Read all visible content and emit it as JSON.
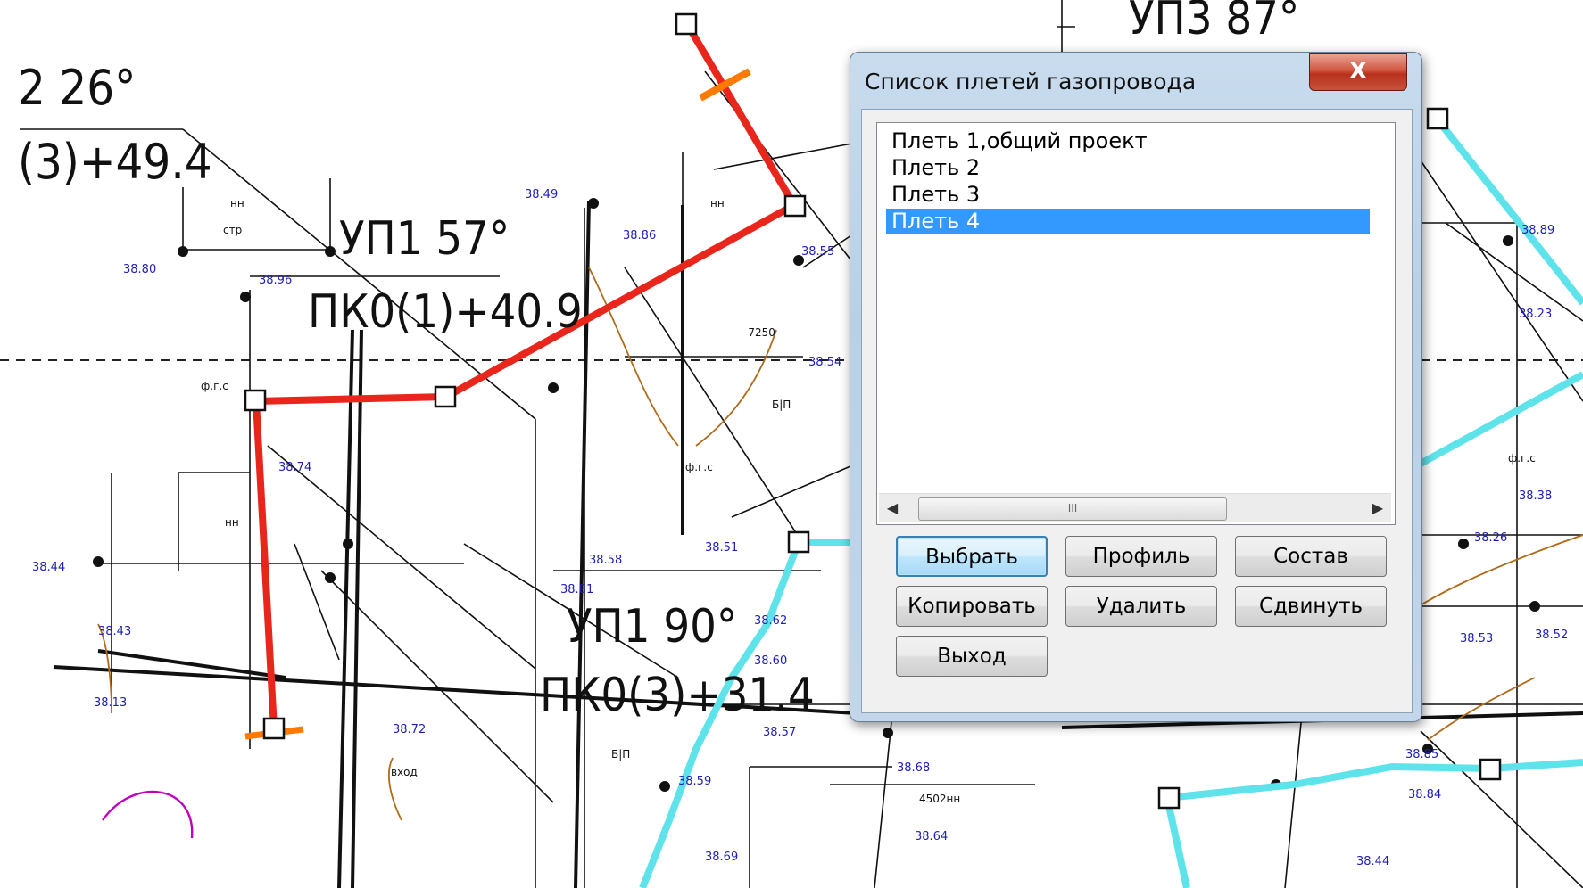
{
  "drawing": {
    "labels": {
      "up2": "2 26°",
      "pk3_49": "(3)+49.4",
      "up1_57": "УП1 57°",
      "pk0_1": "ПК0(1)+40.9",
      "up1_90": "УП1 90°",
      "pk0_3": "ПК0(3)+31.4",
      "up3_87": "УП3 87°"
    },
    "elevations": [
      "38.49",
      "38.80",
      "38.96",
      "38.86",
      "38.55",
      "38.54",
      "38.74",
      "38.44",
      "38.43",
      "38.13",
      "38.58",
      "38.51",
      "38.62",
      "38.60",
      "38.81",
      "38.72",
      "38.57",
      "38.59",
      "38.69",
      "38.68",
      "38.64",
      "38.23",
      "38.38",
      "38.26",
      "38.53",
      "38.52",
      "38.85",
      "38.84",
      "38.89",
      "38.44"
    ],
    "notes": {
      "nn": "нн",
      "str": "стр",
      "fgs": "ф.г.с",
      "bp": "Б|П",
      "minus": "-7250",
      "vkhod": "вход",
      "mark": "4502нн"
    }
  },
  "dialog": {
    "title": "Список плетей  газопровода",
    "close_label": "X",
    "items": [
      {
        "label": "Плеть 1,общий проект",
        "selected": false
      },
      {
        "label": "Плеть 2",
        "selected": false
      },
      {
        "label": "Плеть 3",
        "selected": false
      },
      {
        "label": "Плеть 4",
        "selected": true
      }
    ],
    "scroll_thumb": "III",
    "buttons": {
      "select": "Выбрать",
      "profile": "Профиль",
      "composition": "Состав",
      "copy": "Копировать",
      "delete": "Удалить",
      "shift": "Сдвинуть",
      "exit": "Выход"
    }
  },
  "colors": {
    "pipeline_red": "#e8261c",
    "pipeline_cyan": "#5fe3ea",
    "elevation_blue": "#1f1fb8",
    "selection": "#3399ff"
  }
}
